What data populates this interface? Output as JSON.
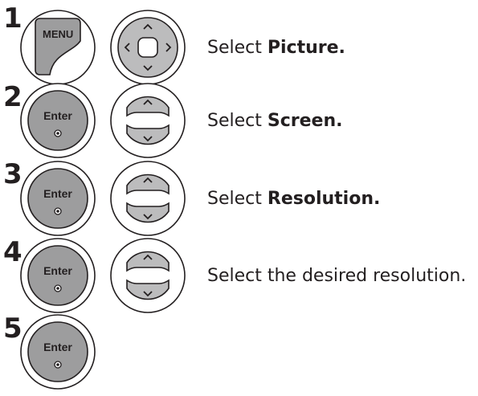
{
  "steps": [
    {
      "number": "1",
      "buttons": [
        "menu-key",
        "nav-four-way"
      ],
      "text_prefix": "Select ",
      "text_bold": "Picture."
    },
    {
      "number": "2",
      "buttons": [
        "enter-key",
        "nav-up-down"
      ],
      "text_prefix": "Select ",
      "text_bold": "Screen."
    },
    {
      "number": "3",
      "buttons": [
        "enter-key",
        "nav-up-down"
      ],
      "text_prefix": "Select ",
      "text_bold": "Resolution."
    },
    {
      "number": "4",
      "buttons": [
        "enter-key",
        "nav-up-down"
      ],
      "text_prefix": "Select the desired resolution.",
      "text_bold": ""
    },
    {
      "number": "5",
      "buttons": [
        "enter-key"
      ],
      "text_prefix": "",
      "text_bold": ""
    }
  ],
  "labels": {
    "menu": "MENU",
    "enter": "Enter"
  },
  "colors": {
    "key_fill": "#9d9d9e",
    "nav_fill": "#bcbcbd",
    "ink": "#231f20"
  }
}
